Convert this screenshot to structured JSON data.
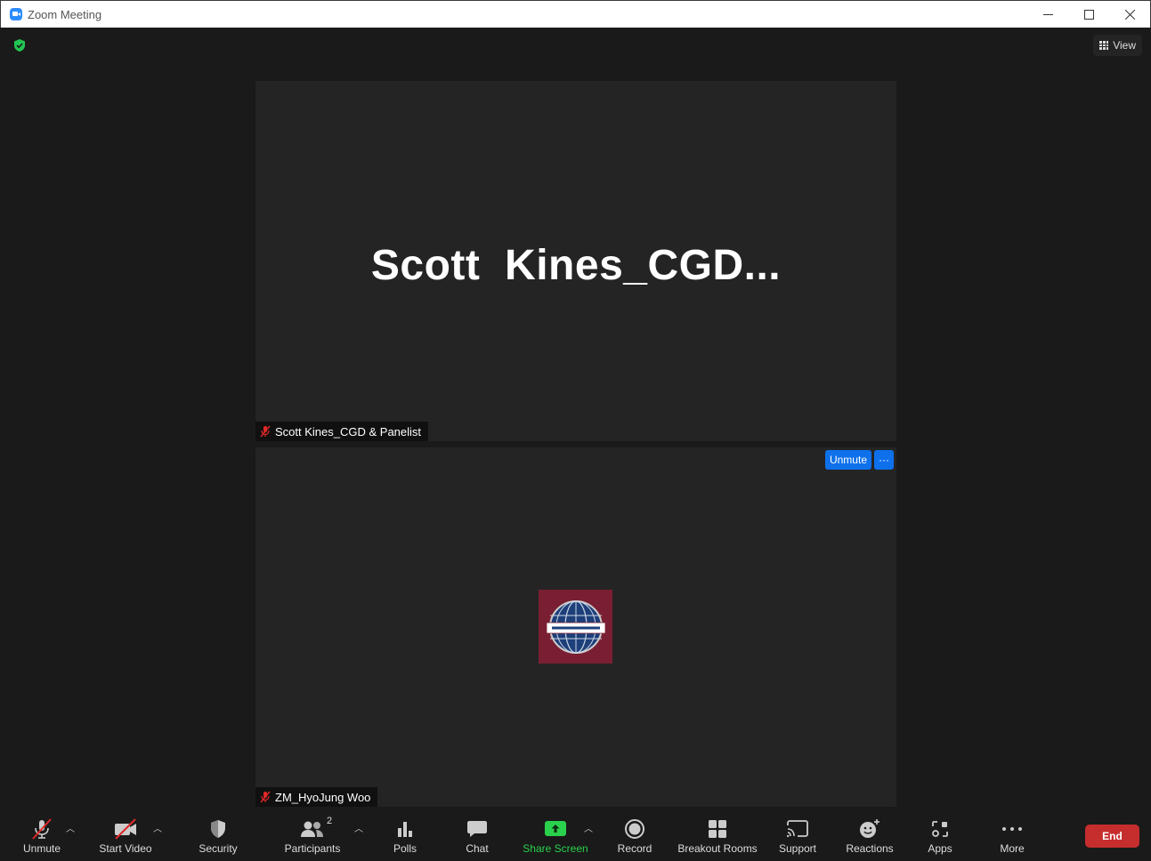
{
  "window": {
    "title": "Zoom Meeting"
  },
  "view": {
    "label": "View"
  },
  "speaker": {
    "display_name": "Scott  Kines_CGD...",
    "tag": "Scott Kines_CGD & Panelist"
  },
  "attendee": {
    "tag": "ZM_HyoJung Woo",
    "unmute_label": "Unmute",
    "more_label": "···"
  },
  "toolbar": {
    "unmute": "Unmute",
    "start_video": "Start Video",
    "security": "Security",
    "participants": "Participants",
    "participants_count": "2",
    "polls": "Polls",
    "chat": "Chat",
    "share_screen": "Share Screen",
    "record": "Record",
    "breakout_rooms": "Breakout Rooms",
    "support": "Support",
    "reactions": "Reactions",
    "apps": "Apps",
    "more": "More",
    "end": "End"
  },
  "colors": {
    "accent": "#0e71eb",
    "end": "#c62d2d",
    "share": "#2ad14c",
    "tile": "#242424",
    "avatar": "#7a1f33"
  }
}
